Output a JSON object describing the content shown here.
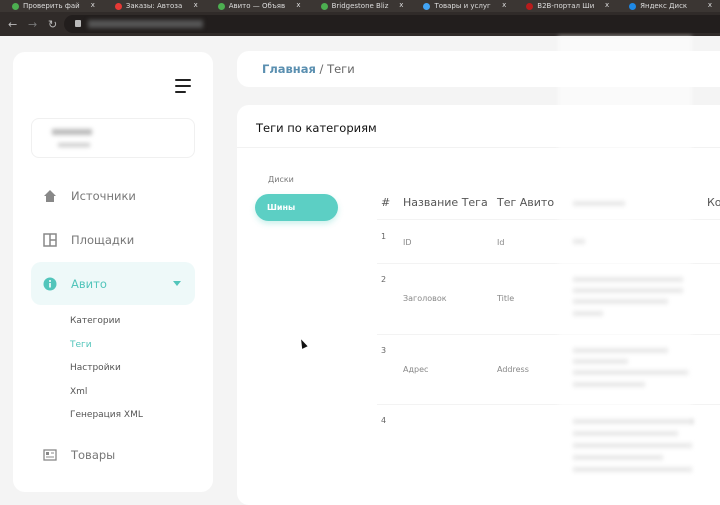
{
  "browser": {
    "tabs": [
      {
        "title": "Проверить фай",
        "color": "#4caf50"
      },
      {
        "title": "Заказы: Автоза",
        "color": "#e53935"
      },
      {
        "title": "Авито — Объяв",
        "color": "#4caf50"
      },
      {
        "title": "Bridgestone Bliz",
        "color": "#4caf50"
      },
      {
        "title": "Товары и услуг",
        "color": "#42a5f5"
      },
      {
        "title": "B2B-портал Ши",
        "color": "#b71c1c"
      },
      {
        "title": "Яндекс Диск",
        "color": "#1e88e5"
      }
    ],
    "close_glyph": "x"
  },
  "sidebar": {
    "items": [
      {
        "label": "Источники",
        "icon": "home-icon"
      },
      {
        "label": "Площадки",
        "icon": "grid-icon"
      },
      {
        "label": "Авито",
        "icon": "info-icon"
      },
      {
        "label": "Товары",
        "icon": "id-card-icon"
      }
    ],
    "subitems": [
      {
        "label": "Категории"
      },
      {
        "label": "Теги"
      },
      {
        "label": "Настройки"
      },
      {
        "label": "Xml"
      },
      {
        "label": "Генерация XML"
      }
    ]
  },
  "breadcrumb": {
    "home": "Главная",
    "sep": "/",
    "current": "Теги"
  },
  "main": {
    "title": "Теги по категориям",
    "categories": [
      "Диски",
      "Шины"
    ],
    "columns": [
      "#",
      "Название Тега",
      "Тег Авито",
      "Ко"
    ],
    "rows": [
      {
        "n": "1",
        "name": "ID",
        "tag": "Id"
      },
      {
        "n": "2",
        "name": "Заголовок",
        "tag": "Title"
      },
      {
        "n": "3",
        "name": "Адрес",
        "tag": "Address"
      },
      {
        "n": "4",
        "name": "",
        "tag": ""
      }
    ]
  },
  "colors": {
    "accent": "#5ccfc4",
    "link": "#5a8fb0"
  }
}
